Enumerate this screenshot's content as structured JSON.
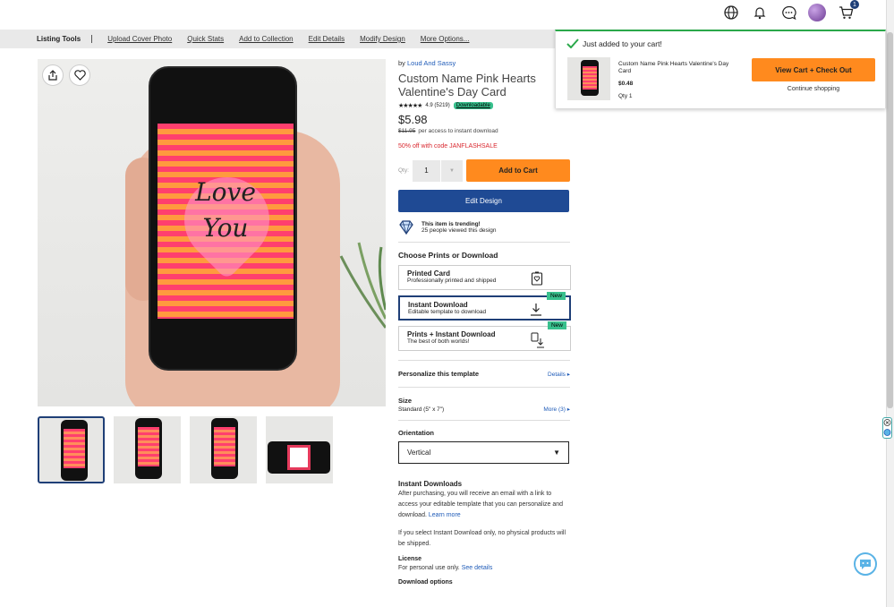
{
  "header": {
    "icons": [
      "globe-icon",
      "bell-icon",
      "chat-icon",
      "avatar",
      "cart-icon"
    ],
    "cart_count": "1"
  },
  "toolbar": {
    "title": "Listing Tools",
    "links": [
      "Upload Cover Photo",
      "Quick Stats",
      "Add to Collection",
      "Edit Details",
      "Modify Design",
      "More Options..."
    ]
  },
  "gallery": {
    "main_text_line1": "Love",
    "main_text_line2": "You"
  },
  "product": {
    "by_prefix": "by",
    "seller": "Loud And Sassy",
    "title": "Custom Name Pink Hearts Valentine's Day Card",
    "stars": "★★★★★",
    "rating": "4.9 (5219)",
    "badge": "Downloadable",
    "price": "$5.98",
    "old_price": "$11.95",
    "price_note": "per access to instant download",
    "promo": "50% off with code JANFLASHSALE",
    "qty_label": "Qty:",
    "qty_value": "1",
    "add_to_cart": "Add to Cart",
    "edit_design": "Edit Design",
    "trending_title": "This item is trending!",
    "trending_sub": "25 people viewed this design"
  },
  "options": {
    "heading": "Choose Prints or Download",
    "items": [
      {
        "title": "Printed Card",
        "sub": "Professionally printed and shipped",
        "tag": ""
      },
      {
        "title": "Instant Download",
        "sub": "Editable template to download",
        "tag": "New"
      },
      {
        "title": "Prints + Instant Download",
        "sub": "The best of both worlds!",
        "tag": "New"
      }
    ]
  },
  "personalize": {
    "label": "Personalize this template",
    "link": "Details"
  },
  "size": {
    "label": "Size",
    "value": "Standard (5\" x 7\")",
    "link": "More (3)"
  },
  "orientation": {
    "label": "Orientation",
    "value": "Vertical"
  },
  "instant": {
    "heading": "Instant Downloads",
    "para1": "After purchasing, you will receive an email with a link to access your editable template that you can personalize and download.",
    "learn_more": "Learn more",
    "para2": "If you select Instant Download only, no physical products will be shipped.",
    "license_label": "License",
    "license_text": "For personal use only.",
    "license_link": "See details",
    "download_options": "Download options"
  },
  "popup": {
    "heading": "Just added to your cart!",
    "item_name": "Custom Name Pink Hearts Valentine's Day Card",
    "item_price": "$0.48",
    "item_qty": "Qty 1",
    "view_cart": "View Cart + Check Out",
    "continue": "Continue shopping"
  },
  "colors": {
    "accent_orange": "#ff8a1e",
    "accent_blue": "#1f4a94",
    "success_green": "#2aa84a",
    "promo_red": "#d9282f"
  }
}
